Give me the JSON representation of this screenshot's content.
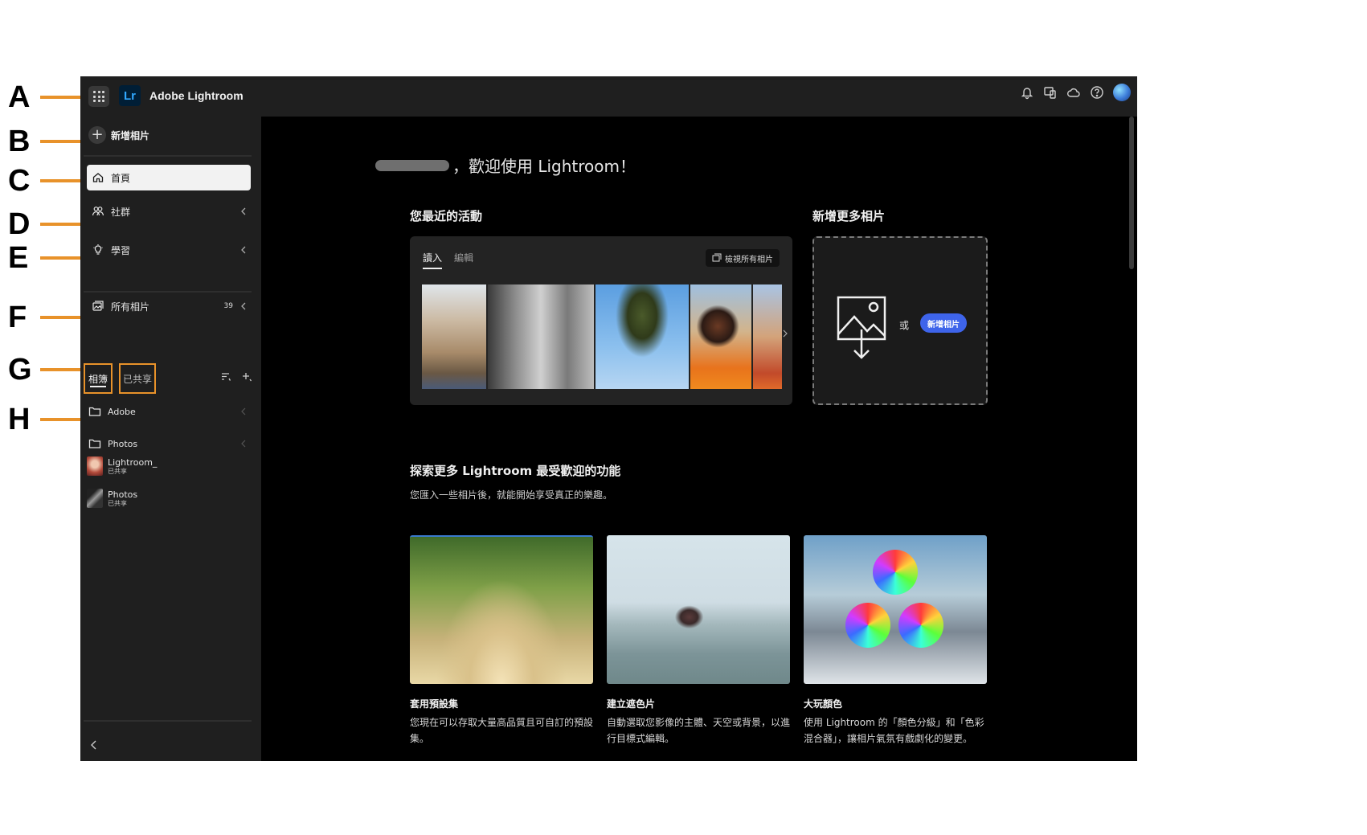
{
  "callouts": [
    {
      "letter": "A"
    },
    {
      "letter": "B"
    },
    {
      "letter": "C"
    },
    {
      "letter": "D"
    },
    {
      "letter": "E"
    },
    {
      "letter": "F"
    },
    {
      "letter": "G"
    },
    {
      "letter": "H"
    }
  ],
  "header": {
    "logo_text": "Lr",
    "app_title": "Adobe Lightroom",
    "icons": [
      "bell-icon",
      "devices-icon",
      "cloud-icon",
      "help-icon",
      "avatar"
    ]
  },
  "sidebar": {
    "add_photos": "新增相片",
    "nav": [
      {
        "label": "首頁",
        "icon": "home-icon"
      },
      {
        "label": "社群",
        "icon": "community-icon"
      },
      {
        "label": "學習",
        "icon": "learn-icon"
      }
    ],
    "all_photos": {
      "label": "所有相片",
      "count": "39"
    },
    "tabs": {
      "albums": "相簿",
      "shared": "已共享"
    },
    "albums": [
      {
        "label": "Adobe"
      },
      {
        "label": "Photos"
      }
    ],
    "shared_albums": [
      {
        "title": "Lightroom_",
        "status": "已共享"
      },
      {
        "title": "Photos",
        "status": "已共享"
      }
    ]
  },
  "main": {
    "welcome": "，歡迎使用 Lightroom！",
    "recent_heading": "您最近的活動",
    "recent_tabs": {
      "import": "讀入",
      "edit": "編輯"
    },
    "view_all": "檢視所有相片",
    "add_more_heading": "新增更多相片",
    "or_text": "或",
    "add_button": "新增相片",
    "explore_heading": "探索更多 Lightroom 最受歡迎的功能",
    "explore_sub": "您匯入一些相片後，就能開始享受真正的樂趣。",
    "features": [
      {
        "title": "套用預設集",
        "desc": "您現在可以存取大量高品質且可自訂的預設集。"
      },
      {
        "title": "建立遮色片",
        "desc": "自動選取您影像的主體、天空或背景，以進行目標式編輯。"
      },
      {
        "title": "大玩顏色",
        "desc": "使用 Lightroom 的「顏色分級」和「色彩混合器」，讓相片氣氛有戲劇化的變更。"
      }
    ]
  },
  "colors": {
    "accent_blue": "#3e64ea",
    "callout_orange": "#e8922a",
    "lr_blue": "#31a8ff"
  }
}
